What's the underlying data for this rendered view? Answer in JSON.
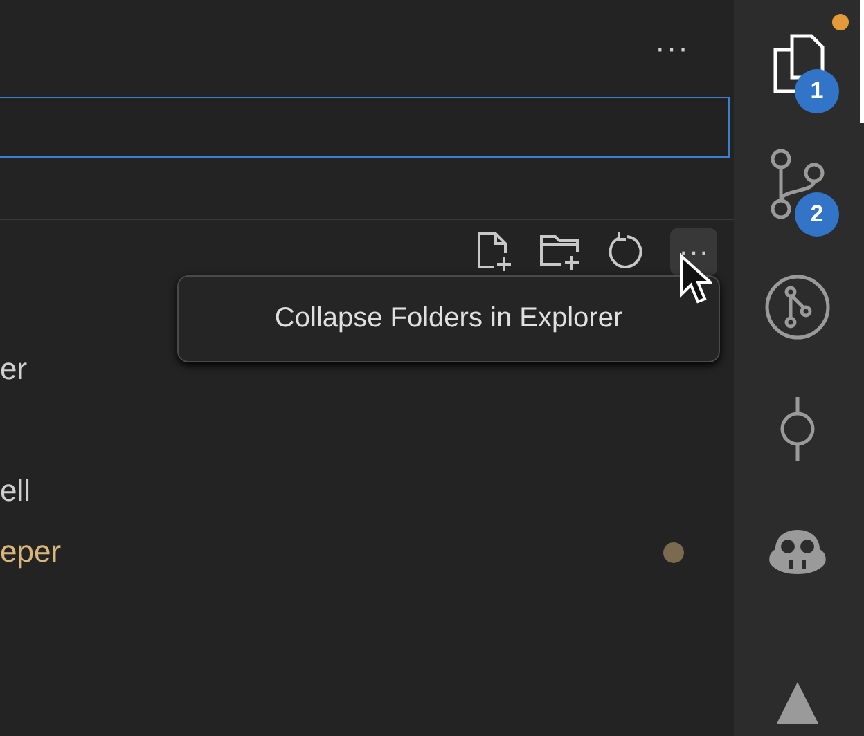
{
  "toolbar": {
    "more": "···"
  },
  "explorer_actions": {
    "more": "···",
    "tooltip": "Collapse Folders in Explorer"
  },
  "tree": [
    {
      "label": "er",
      "modified": false
    },
    {
      "label": "ell",
      "modified": false
    },
    {
      "label": "eper",
      "modified": true
    }
  ],
  "activity_bar": [
    {
      "kind": "files",
      "selected": true,
      "badge": "1",
      "dot": true
    },
    {
      "kind": "branch",
      "selected": false,
      "badge": "2",
      "dot": false
    },
    {
      "kind": "pull",
      "selected": false
    },
    {
      "kind": "commit",
      "selected": false
    },
    {
      "kind": "bot",
      "selected": false
    },
    {
      "kind": "triangle",
      "selected": false
    }
  ]
}
